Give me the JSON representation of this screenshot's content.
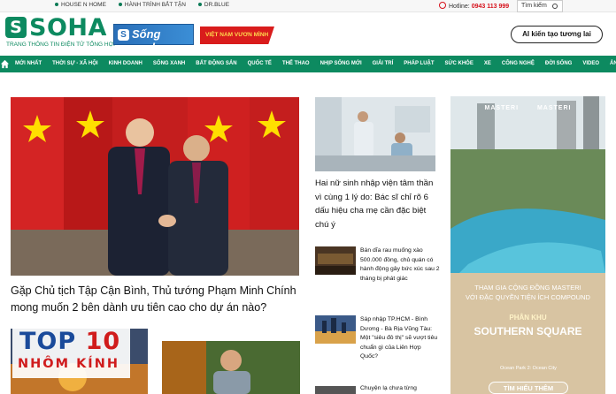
{
  "topbar": {
    "links": [
      "HOUSE N HOME",
      "HÀNH TRÌNH BẮT TẬN",
      "DR.BLUE"
    ],
    "hotline_label": "Hotline:",
    "hotline_number": "0943 113 999",
    "search_label": "Tìm kiếm"
  },
  "header": {
    "logo_letter": "S",
    "logo_text": "SOHA",
    "tagline": "TRANG THÔNG TIN ĐIỆN TỬ TỔNG HỢP",
    "song_xanh": "Sống xanh",
    "viet_nam_banner": "VIỆT NAM VƯƠN MÌNH",
    "ai_button": "AI kiến tạo tương lai"
  },
  "nav": {
    "items": [
      "MỚI NHẤT",
      "THỜI SỰ - XÃ HỘI",
      "KINH DOANH",
      "SỐNG XANH",
      "BẤT ĐỘNG SẢN",
      "QUỐC TẾ",
      "THỂ THAO",
      "NHỊP SỐNG MỚI",
      "GIẢI TRÍ",
      "PHÁP LUẬT",
      "SỨC KHỎE",
      "XE",
      "CÔNG NGHỆ",
      "ĐỜI SỐNG",
      "VIDEO",
      "ẢNH"
    ]
  },
  "main_story": {
    "title": "Gặp Chủ tịch Tập Cận Bình, Thủ tướng Phạm Minh Chính mong muốn 2 bên dành ưu tiên cao cho dự án nào?"
  },
  "side_stories": [
    {
      "title": "Hai nữ sinh nhập viện tâm thần vì cùng 1 lý do: Bác sĩ chỉ rõ 6 dấu hiệu cha mẹ cần đặc biệt chú ý"
    },
    {
      "title": "Bán dĩa rau muống xào 500.000 đồng, chủ quán có hành động gây bức xúc sau 2 tháng bị phát giác"
    },
    {
      "title": "Sáp nhập TP.HCM - Bình Dương - Bà Rịa Vũng Tàu: Một \"siêu đô thị\" sẽ vượt tiêu chuẩn gì của Liên Hợp Quốc?"
    },
    {
      "title": "Chuyện lạ chưa từng"
    }
  ],
  "ad": {
    "brand_1": "MASTERI",
    "brand_2": "MASTERI",
    "headline_1": "THAM GIA CỘNG ĐỒNG MASTERI",
    "headline_2": "VỚI ĐẶC QUYỀN TIỆN ÍCH COMPOUND",
    "zone_label": "PHÂN KHU",
    "zone_name": "SOUTHERN SQUARE",
    "location": "Ocean Park 2: Ocean City",
    "cta": "TÌM HIỂU THÊM"
  },
  "promo": {
    "top_label": "TOP",
    "top_number": "10",
    "subtitle": "NHÔM KÍNH"
  },
  "colors": {
    "brand_green": "#0d8a60",
    "accent_red": "#d6121c"
  }
}
